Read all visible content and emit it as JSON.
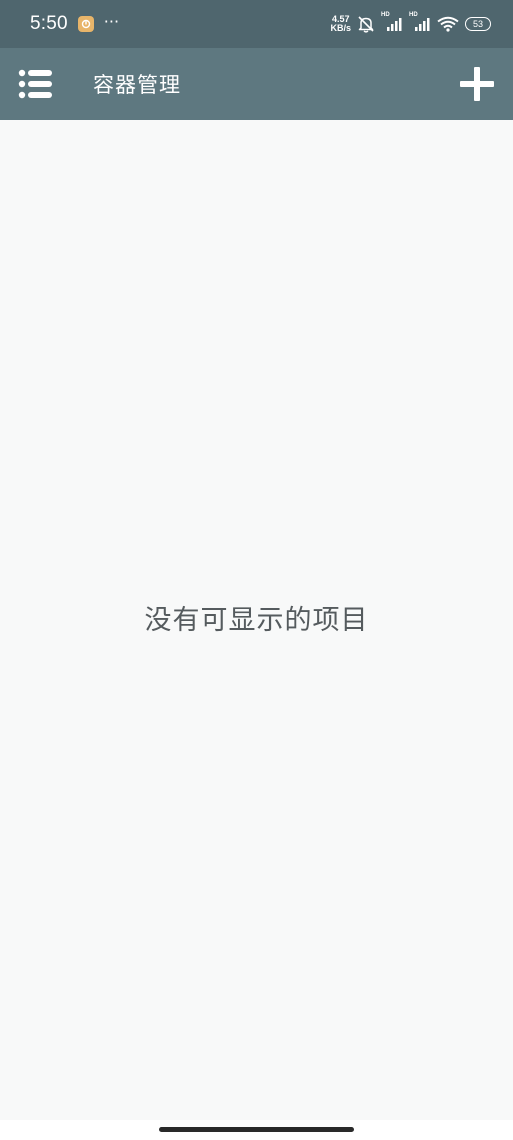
{
  "colors": {
    "status_bar": "#4f666e",
    "toolbar": "#5e7880",
    "background": "#f8f9f9",
    "empty_text": "#555b5e",
    "app_notification_icon": "#e8b56a"
  },
  "status_bar": {
    "time": "5:50",
    "more": "···",
    "net_speed_value": "4.57",
    "net_speed_unit": "KB/s",
    "signal_1_tag": "HD",
    "signal_2_tag": "HD",
    "battery": "53",
    "icons": [
      "app-notification-icon",
      "mute-bell-icon",
      "signal-icon",
      "signal-icon",
      "wifi-icon",
      "battery-icon"
    ]
  },
  "toolbar": {
    "title": "容器管理",
    "menu_icon": "list-menu-icon",
    "add_icon": "plus-icon"
  },
  "content": {
    "empty_message": "没有可显示的项目"
  }
}
